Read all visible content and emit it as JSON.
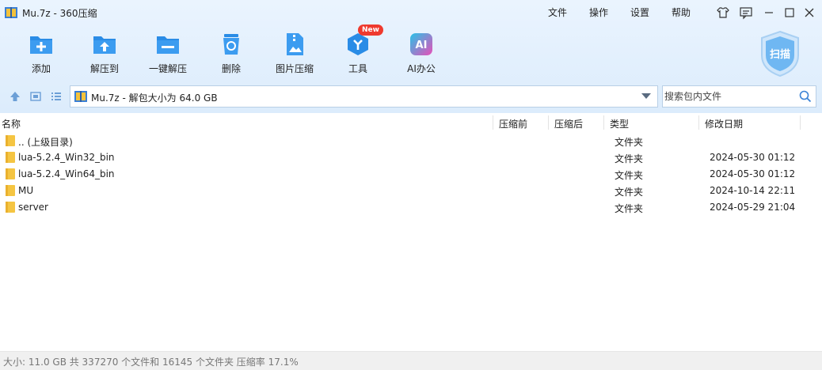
{
  "window": {
    "title": "Mu.7z - 360压缩",
    "menu": [
      "文件",
      "操作",
      "设置",
      "帮助"
    ]
  },
  "toolbar": {
    "items": [
      {
        "label": "添加",
        "icon": "add-folder-icon"
      },
      {
        "label": "解压到",
        "icon": "extract-to-icon"
      },
      {
        "label": "一键解压",
        "icon": "one-click-extract-icon"
      },
      {
        "label": "删除",
        "icon": "trash-icon"
      },
      {
        "label": "图片压缩",
        "icon": "image-compress-icon"
      },
      {
        "label": "工具",
        "icon": "tools-icon",
        "badge": "New"
      },
      {
        "label": "AI办公",
        "icon": "ai-icon"
      }
    ],
    "scan_label": "扫描"
  },
  "nav": {
    "path": "Mu.7z - 解包大小为 64.0 GB",
    "search_placeholder": "搜索包内文件"
  },
  "columns": {
    "name": "名称",
    "before": "压缩前",
    "after": "压缩后",
    "type": "类型",
    "modified": "修改日期"
  },
  "rows": [
    {
      "name": ".. (上级目录)",
      "type": "文件夹",
      "date": ""
    },
    {
      "name": "lua-5.2.4_Win32_bin",
      "type": "文件夹",
      "date": "2024-05-30 01:12"
    },
    {
      "name": "lua-5.2.4_Win64_bin",
      "type": "文件夹",
      "date": "2024-05-30 01:12"
    },
    {
      "name": "MU",
      "type": "文件夹",
      "date": "2024-10-14 22:11"
    },
    {
      "name": "server",
      "type": "文件夹",
      "date": "2024-05-29 21:04"
    }
  ],
  "status": "大小: 11.0 GB 共 337270 个文件和 16145 个文件夹 压缩率 17.1%",
  "colors": {
    "accent": "#2a8ce6",
    "folder": "#f5c542",
    "badge": "#ef3a2e",
    "ai_gradient_start": "#27c3e8",
    "ai_gradient_end": "#e84fb8"
  }
}
